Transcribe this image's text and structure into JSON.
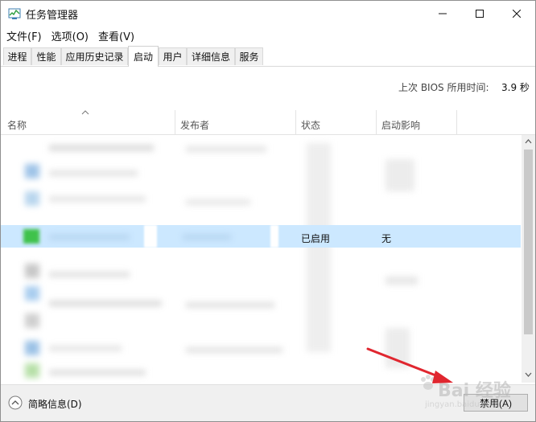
{
  "window": {
    "title": "任务管理器",
    "app_icon": "task-manager-icon"
  },
  "title_controls": {
    "minimize": "minimize-icon",
    "maximize": "maximize-icon",
    "close": "close-icon"
  },
  "menu": [
    {
      "label": "文件(F)"
    },
    {
      "label": "选项(O)"
    },
    {
      "label": "查看(V)"
    }
  ],
  "tabs": [
    {
      "label": "进程"
    },
    {
      "label": "性能"
    },
    {
      "label": "应用历史记录"
    },
    {
      "label": "启动",
      "active": true
    },
    {
      "label": "用户"
    },
    {
      "label": "详细信息"
    },
    {
      "label": "服务"
    }
  ],
  "bios": {
    "label": "上次 BIOS 所用时间:",
    "value": "3.9 秒"
  },
  "columns": [
    {
      "label": "名称"
    },
    {
      "label": "发布者"
    },
    {
      "label": "状态"
    },
    {
      "label": "启动影响"
    }
  ],
  "selected_row": {
    "status": "已启用",
    "impact": "无"
  },
  "footer": {
    "fewer_details": "简略信息(D)",
    "disable_button": "禁用(A)"
  },
  "watermark": {
    "text": "Bai 经验",
    "sub": "jingyan.baidu.com"
  },
  "colors": {
    "selection": "#cce8ff",
    "arrow": "#e0262f",
    "footer_bg": "#f0f0f0"
  }
}
